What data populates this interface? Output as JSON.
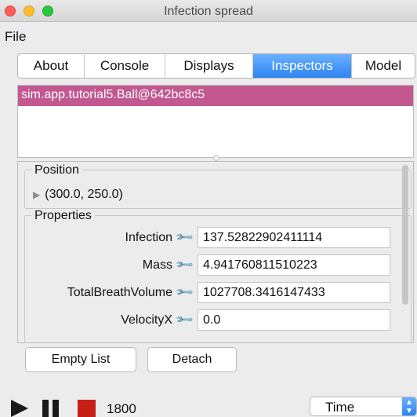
{
  "window": {
    "title": "Infection spread"
  },
  "menubar": {
    "file": "File"
  },
  "tabs": [
    {
      "label": "About",
      "active": false
    },
    {
      "label": "Console",
      "active": false
    },
    {
      "label": "Displays",
      "active": false
    },
    {
      "label": "Inspectors",
      "active": true
    },
    {
      "label": "Model",
      "active": false
    }
  ],
  "inspector_list": {
    "selected_item": "sim.app.tutorial5.Ball@642bc8c5"
  },
  "position": {
    "title": "Position",
    "value": "(300.0, 250.0)"
  },
  "properties": {
    "title": "Properties",
    "rows": [
      {
        "label": "Infection",
        "value": "137.52822902411114",
        "icon": "wrench-icon"
      },
      {
        "label": "Mass",
        "value": "4.941760811510223",
        "icon": "wrench-icon"
      },
      {
        "label": "TotalBreathVolume",
        "value": "1027708.3416147433",
        "icon": "wrench-icon"
      },
      {
        "label": "VelocityX",
        "value": "0.0",
        "icon": "wrench-icon"
      }
    ]
  },
  "buttons": {
    "empty_list": "Empty List",
    "detach": "Detach"
  },
  "controls": {
    "steps": "1800",
    "time_select": "Time",
    "play_icon": "play-icon",
    "pause_icon": "pause-icon",
    "stop_icon": "stop-icon"
  },
  "colors": {
    "selected_item": "#c2588f",
    "active_tab": "#2e84f0",
    "stop": "#c61f18"
  }
}
